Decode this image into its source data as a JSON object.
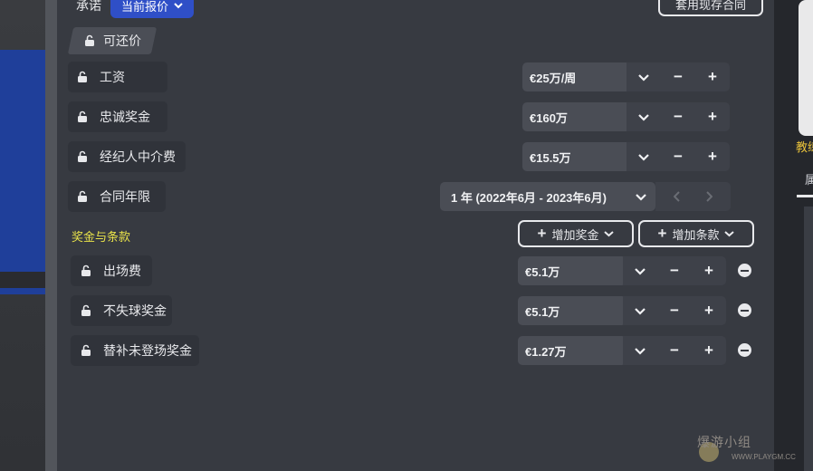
{
  "header": {
    "commit_label": "承诺",
    "offer_dropdown": "当前报价",
    "template_button": "套用现存合同"
  },
  "negotiable": {
    "label": "可还价"
  },
  "terms": [
    {
      "label": "工资",
      "value": "€25万/周"
    },
    {
      "label": "忠诚奖金",
      "value": "€160万"
    },
    {
      "label": "经纪人中介费",
      "value": "€15.5万"
    }
  ],
  "contract_length": {
    "label": "合同年限",
    "value": "1 年 (2022年6月 - 2023年6月)"
  },
  "bonuses": {
    "title": "奖金与条款",
    "add_bonus": "增加奖金",
    "add_clause": "增加条款",
    "items": [
      {
        "label": "出场费",
        "value": "€5.1万"
      },
      {
        "label": "不失球奖金",
        "value": "€5.1万"
      },
      {
        "label": "替补未登场奖金",
        "value": "€1.27万"
      }
    ]
  },
  "right_panel": {
    "label": "教练",
    "tab": "属"
  },
  "watermark": {
    "text": "爆游小组",
    "sub": "WWW.PLAYGM.CC"
  },
  "colors": {
    "accent_blue": "#2f4fc7",
    "section_yellow": "#e9e34a",
    "panel": "#373a41"
  }
}
